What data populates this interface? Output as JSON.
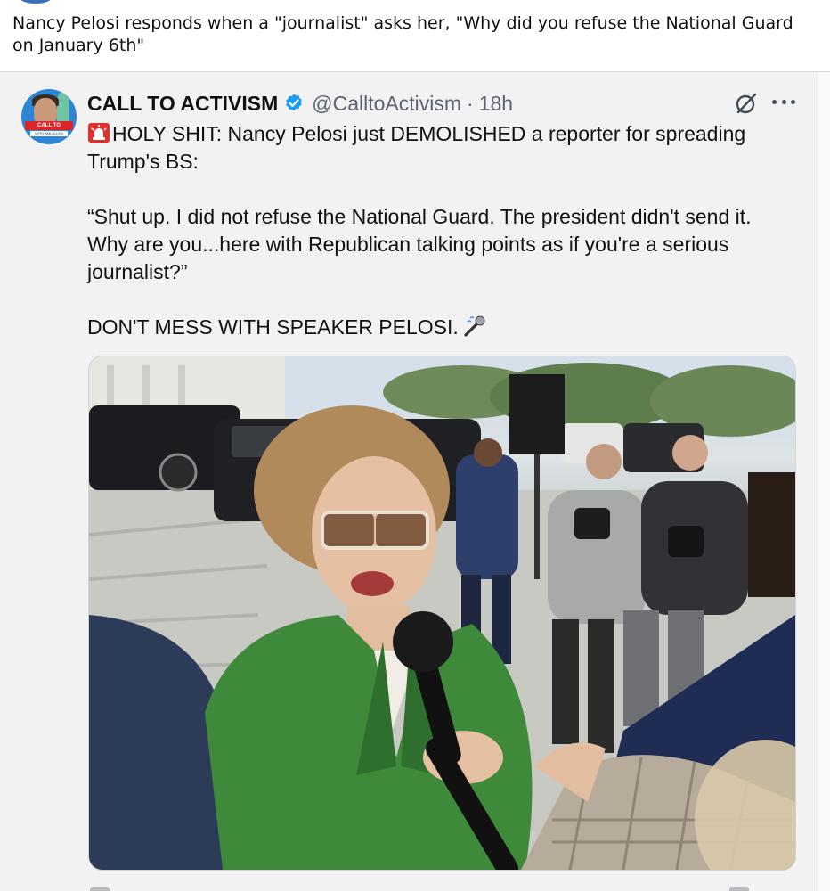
{
  "post": {
    "caption": "Nancy Pelosi responds when a \"journalist\" asks her, \"Why did you refuse the National Guard on January 6th\""
  },
  "tweet": {
    "display_name": "CALL TO ACTIVISM",
    "handle": "@CalltoActivism",
    "separator": "·",
    "time": "18h",
    "line1": "HOLY SHIT: Nancy Pelosi just DEMOLISHED a reporter for spreading Trump's BS:",
    "quote": "“Shut up. I did not refuse the National Guard. The president didn't send it. Why are you...here with Republican talking points as if you're a serious journalist?”",
    "closing": "DON'T MESS WITH SPEAKER PELOSI.",
    "icons": {
      "verified": "verified-badge-icon",
      "siren": "rotating-light-icon",
      "mic": "microphone-icon",
      "grok": "grok-icon",
      "more": "more-horizontal-icon"
    },
    "avatar_label": "CALL TO ACTIVISM",
    "avatar_sub": "WITH AMI ALLEN"
  },
  "colors": {
    "verified": "#1d9bf0",
    "siren": "#e0302a",
    "text": "#111111",
    "muted": "#5b6470",
    "card_bg": "#f2f2f2",
    "jacket": "#3e8a3a"
  }
}
